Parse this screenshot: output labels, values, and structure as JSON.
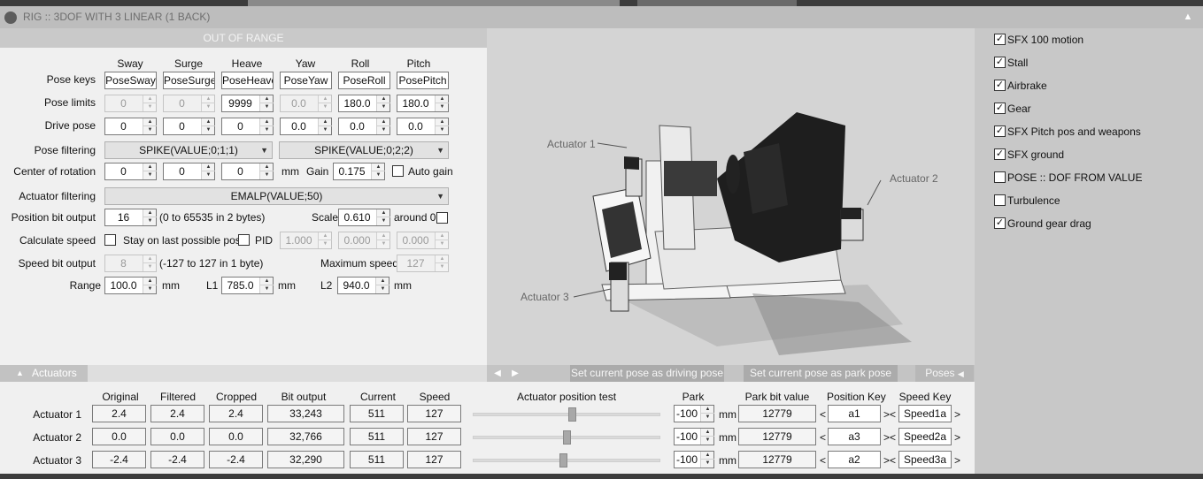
{
  "window": {
    "title": "RIG :: 3DOF WITH 3 LINEAR (1 BACK)",
    "status": "OUT OF RANGE"
  },
  "axes": [
    "Sway",
    "Surge",
    "Heave",
    "Yaw",
    "Roll",
    "Pitch"
  ],
  "rows": {
    "pose_keys": {
      "label": "Pose keys",
      "values": [
        "PoseSway",
        "PoseSurge",
        "PoseHeave",
        "PoseYaw",
        "PoseRoll",
        "PosePitch"
      ]
    },
    "pose_limits": {
      "label": "Pose limits",
      "values": [
        "0",
        "0",
        "9999",
        "0.0",
        "180.0",
        "180.0"
      ]
    },
    "drive_pose": {
      "label": "Drive pose",
      "values": [
        "0",
        "0",
        "0",
        "0.0",
        "0.0",
        "0.0"
      ]
    }
  },
  "pose_filtering": {
    "label": "Pose filtering",
    "left": "SPIKE(VALUE;0;1;1)",
    "right": "SPIKE(VALUE;0;2;2)"
  },
  "center_of_rotation": {
    "label": "Center of rotation",
    "values": [
      "0",
      "0",
      "0"
    ],
    "unit": "mm",
    "gain_label": "Gain",
    "gain": "0.175",
    "auto_gain": "Auto gain"
  },
  "actuator_filtering": {
    "label": "Actuator filtering",
    "value": "EMALP(VALUE;50)"
  },
  "position_bit_output": {
    "label": "Position bit output",
    "value": "16",
    "hint": "(0 to 65535 in 2 bytes)",
    "scale_label": "Scale",
    "scale": "0.610",
    "around_label": "around 0"
  },
  "calculate_speed": {
    "label": "Calculate speed",
    "stay_label": "Stay on last possible pose",
    "pid_label": "PID",
    "pid": [
      "1.000",
      "0.000",
      "0.000"
    ]
  },
  "speed_bit_output": {
    "label": "Speed bit output",
    "value": "8",
    "hint": "(-127 to 127 in 1 byte)",
    "max_label": "Maximum speed",
    "max": "127"
  },
  "range": {
    "label": "Range",
    "value": "100.0",
    "unit": "mm",
    "l1_label": "L1",
    "l1": "785.0",
    "l2_label": "L2",
    "l2": "940.0"
  },
  "preview": {
    "labels": [
      "Actuator 1",
      "Actuator 2",
      "Actuator 3"
    ],
    "btn_drive": "Set current pose as driving pose",
    "btn_park": "Set current pose as park pose",
    "poses_tab": "Poses"
  },
  "actuators_tab": "Actuators",
  "table": {
    "headers": [
      "Original",
      "Filtered",
      "Cropped",
      "Bit output",
      "Current",
      "Speed"
    ],
    "test_header": "Actuator position test",
    "park_header": "Park",
    "park_bit_header": "Park bit value",
    "pos_key_header": "Position Key",
    "speed_key_header": "Speed Key",
    "rows": [
      {
        "name": "Actuator 1",
        "values": [
          "2.4",
          "2.4",
          "2.4",
          "33,243",
          "511",
          "127"
        ],
        "test": 0.53,
        "park": "-100",
        "park_bit": "12779",
        "pos_key": "a1",
        "speed_key": "Speed1a"
      },
      {
        "name": "Actuator 2",
        "values": [
          "0.0",
          "0.0",
          "0.0",
          "32,766",
          "511",
          "127"
        ],
        "test": 0.5,
        "park": "-100",
        "park_bit": "12779",
        "pos_key": "a3",
        "speed_key": "Speed2a"
      },
      {
        "name": "Actuator 3",
        "values": [
          "-2.4",
          "-2.4",
          "-2.4",
          "32,290",
          "511",
          "127"
        ],
        "test": 0.48,
        "park": "-100",
        "park_bit": "12779",
        "pos_key": "a2",
        "speed_key": "Speed3a"
      }
    ]
  },
  "effects": [
    {
      "label": "SFX 100 motion",
      "checked": true
    },
    {
      "label": "Stall",
      "checked": true
    },
    {
      "label": "Airbrake",
      "checked": true
    },
    {
      "label": "Gear",
      "checked": true
    },
    {
      "label": "SFX Pitch pos and weapons",
      "checked": true
    },
    {
      "label": "SFX ground",
      "checked": true
    },
    {
      "label": "POSE :: DOF FROM VALUE",
      "checked": false
    },
    {
      "label": "Turbulence",
      "checked": false
    },
    {
      "label": "Ground gear drag",
      "checked": true
    }
  ]
}
